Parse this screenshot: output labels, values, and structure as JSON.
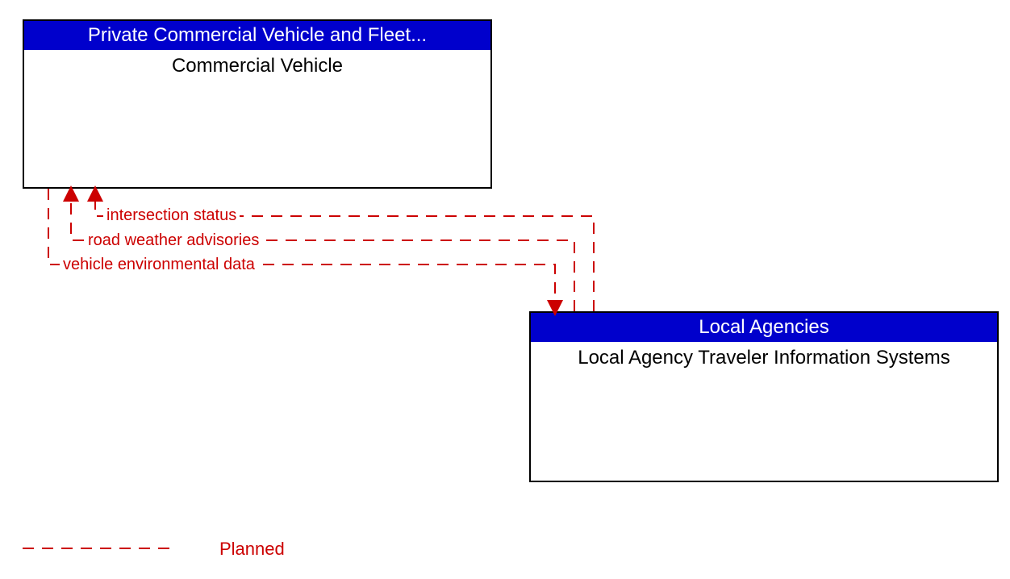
{
  "boxes": {
    "top": {
      "header": "Private Commercial Vehicle and Fleet...",
      "body": "Commercial Vehicle"
    },
    "bottom": {
      "header": "Local Agencies",
      "body": "Local Agency Traveler Information Systems"
    }
  },
  "flows": {
    "f1": "intersection status",
    "f2": "road weather advisories",
    "f3": "vehicle environmental data"
  },
  "legend": {
    "planned": "Planned"
  },
  "colors": {
    "header_bg": "#0000cc",
    "flow": "#cc0000"
  }
}
